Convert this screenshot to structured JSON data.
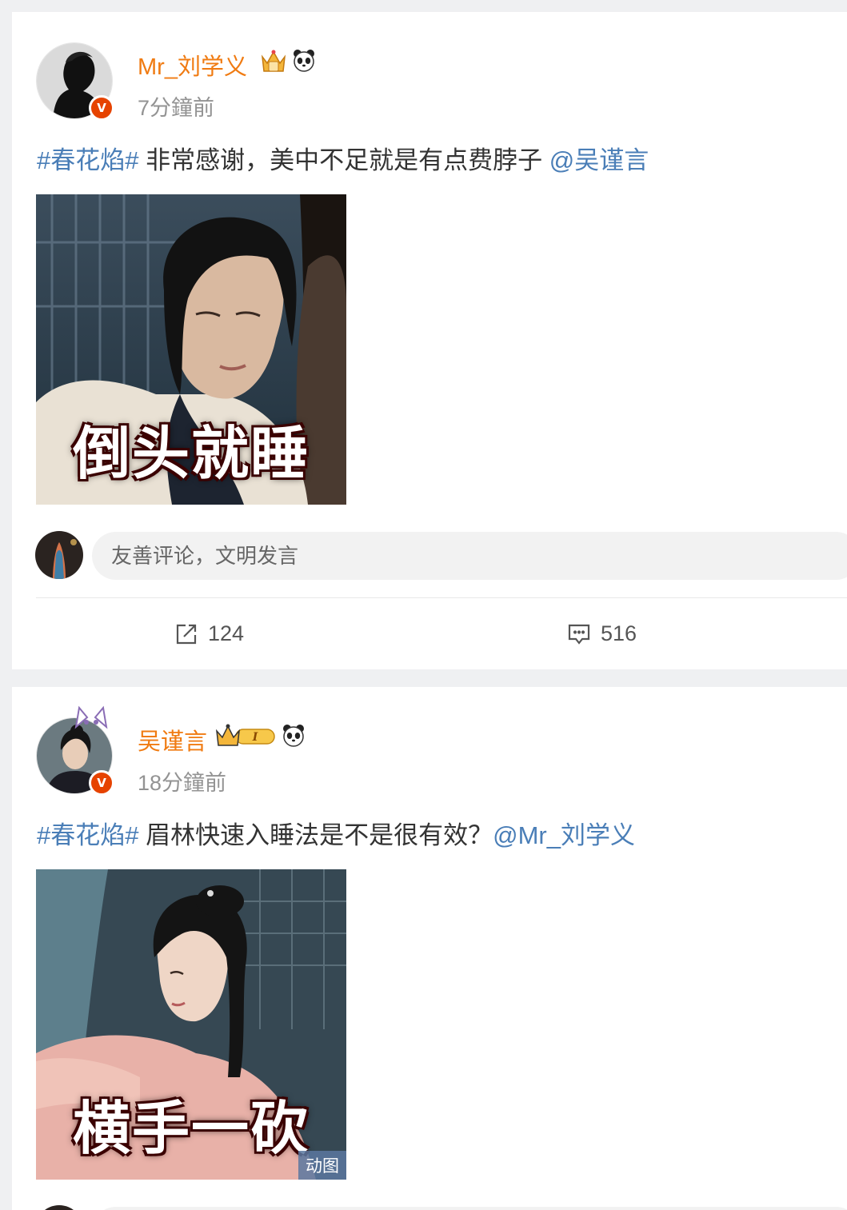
{
  "posts": [
    {
      "username": "Mr_刘学义",
      "time": "7分鐘前",
      "hashtag": "#春花焰#",
      "text": " 非常感谢，美中不足就是有点费脖子 ",
      "mention": "@吴谨言",
      "image_caption": "倒头就睡",
      "comment_placeholder": "友善评论，文明发言",
      "repost_count": "124",
      "comment_count": "516"
    },
    {
      "username": "吴谨言",
      "time": "18分鐘前",
      "hashtag": "#春花焰#",
      "text": " 眉林快速入睡法是不是很有效？",
      "mention": "@Mr_刘学义",
      "image_caption": "横手一砍",
      "gif_label": "动图",
      "level_badge": "I"
    }
  ],
  "verified_badge": "V",
  "icons": [
    "crown-badge-icon",
    "panda-icon",
    "repost-icon",
    "comment-icon"
  ],
  "colors": {
    "username": "#f07b12",
    "link": "#4a7eb7",
    "verified": "#e64300"
  }
}
